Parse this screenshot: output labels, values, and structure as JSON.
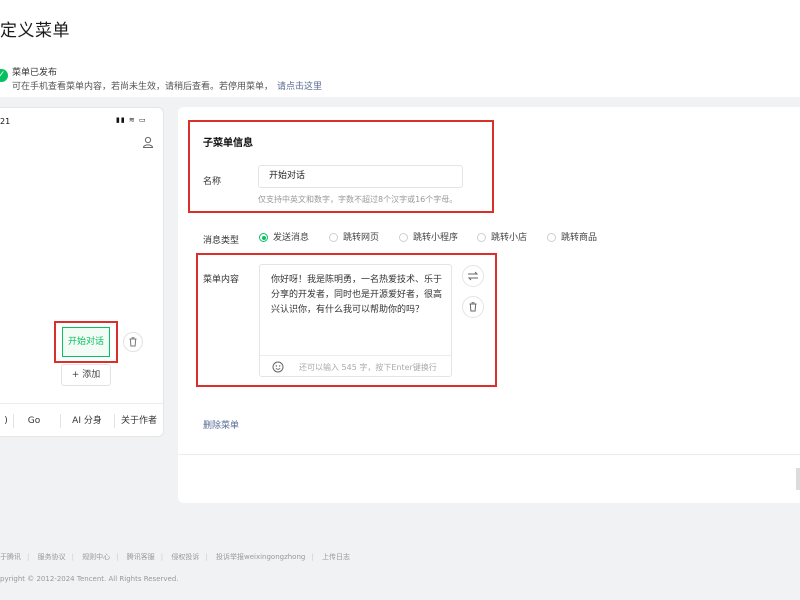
{
  "header": {
    "title": "定义菜单"
  },
  "notice": {
    "title": "菜单已发布",
    "text": "可在手机查看菜单内容，若尚未生效，请稍后查看。若停用菜单，",
    "link": "请点击这里"
  },
  "phone": {
    "time": "21",
    "preview_button": "开始对话",
    "add_label": "+ 添加",
    "menubar": [
      "Go",
      "AI 分身",
      "关于作者"
    ]
  },
  "submenu": {
    "section_title": "子菜单信息",
    "name_label": "名称",
    "name_value": "开始对话",
    "name_hint": "仅支持中英文和数字，字数不超过8个汉字或16个字母。"
  },
  "message_type": {
    "label": "消息类型",
    "options": [
      "发送消息",
      "跳转网页",
      "跳转小程序",
      "跳转小店",
      "跳转商品"
    ],
    "selected": "发送消息"
  },
  "menu_content": {
    "label": "菜单内容",
    "text": "你好呀！我是陈明勇，一名热爱技术、乐于分享的开发者，同时也是开源爱好者，很高兴认识你，有什么我可以帮助你的吗？",
    "counter": "还可以输入 545 字，按下Enter键换行"
  },
  "actions": {
    "delete_menu": "删除菜单"
  },
  "footer": {
    "links": [
      "于腾讯",
      "服务协议",
      "规则中心",
      "腾讯客服",
      "侵权投诉",
      "投诉举报weixingongzhong",
      "上传日志"
    ],
    "copyright": "pyright © 2012-2024 Tencent. All Rights Reserved."
  },
  "colors": {
    "accent": "#07c160",
    "highlight": "#d9302c",
    "link": "#576b95"
  },
  "icons": [
    "check-circle-icon",
    "user-icon",
    "trash-icon",
    "plus-icon",
    "emoji-icon",
    "swap-icon"
  ]
}
